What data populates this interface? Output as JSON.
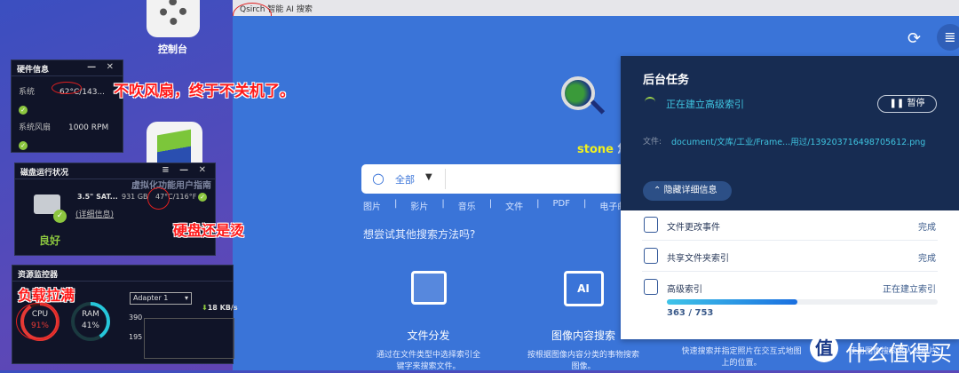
{
  "desktop": {
    "control_panel_label": "控制台",
    "app_label": "虚拟化功能用户指南"
  },
  "hardware_widget": {
    "title": "硬件信息",
    "rows": [
      {
        "label": "系统",
        "value": "62°C/143..."
      },
      {
        "label": "系统风扇",
        "value": "1000 RPM"
      }
    ]
  },
  "disk_widget": {
    "title": "磁盘运行状况",
    "disk_name": "3.5\" SAT...",
    "size": "931 GB",
    "temp": "47°C/116°F",
    "details_link": "(详细信息)",
    "status": "良好"
  },
  "resource_widget": {
    "title": "资源监控器",
    "cpu_label": "CPU",
    "cpu_value": "91%",
    "cpu_percent": 91,
    "ram_label": "RAM",
    "ram_value": "41%",
    "ram_percent": 41,
    "adapter": "Adapter 1",
    "download": "18 KB/s",
    "y_ticks": [
      "390",
      "195"
    ]
  },
  "annotations": {
    "fan": "不吹风扇，终于不关机了。",
    "disk": "硬盘还是烫",
    "load": "负载拉满"
  },
  "qsirch": {
    "window_title": "Qsirch 智能 AI 搜索",
    "greeting_user": "stone",
    "greeting_suffix": "您",
    "search": {
      "scope": "全部",
      "placeholder": ""
    },
    "categories": [
      "图片",
      "影片",
      "音乐",
      "文件",
      "PDF",
      "电子邮件"
    ],
    "try_other": "想尝试其他搜索方法吗?",
    "features": [
      {
        "title": "文件分发",
        "desc": "通过在文件类型中选择索引全键字来搜索文件。"
      },
      {
        "title": "图像内容搜索",
        "desc": "按根据图像内容分类的事物搜索图像。"
      },
      {
        "title": "",
        "desc": "快速搜索并指定照片在交互式地图上的位置。"
      },
      {
        "title": "",
        "desc": "使用图像搜索某人的照片。"
      }
    ]
  },
  "bg_tasks": {
    "title": "后台任务",
    "current_task": "正在建立高级索引",
    "pause_label": "暂停",
    "file_label": "文件:",
    "file_path": "document/文库/工业/Frame...用过/139203716498705612.png",
    "hide_details": "隐藏详细信息",
    "tasks": [
      {
        "label": "文件更改事件",
        "status": "完成"
      },
      {
        "label": "共享文件夹索引",
        "status": "完成"
      },
      {
        "label": "高级索引",
        "status": "正在建立索引"
      }
    ],
    "progress_text": "363 / 753",
    "progress_done": 363,
    "progress_total": 753
  },
  "watermark": "什么值得买",
  "colors": {
    "accent": "#3a74d8",
    "panel_dark": "#172c52",
    "ok_green": "#8cc63f",
    "cpu_red": "#e53935",
    "ram_teal": "#26c6da"
  }
}
